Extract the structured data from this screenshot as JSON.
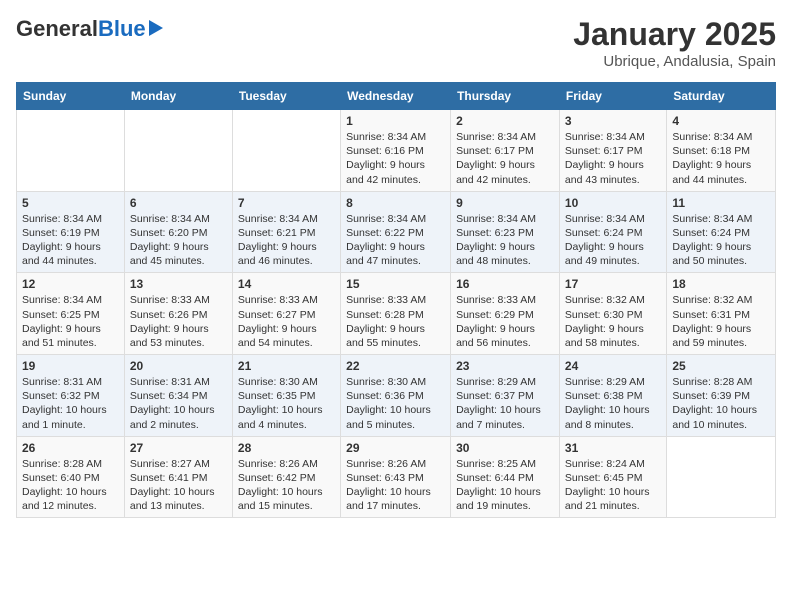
{
  "header": {
    "logo_general": "General",
    "logo_blue": "Blue",
    "month": "January 2025",
    "location": "Ubrique, Andalusia, Spain"
  },
  "days_of_week": [
    "Sunday",
    "Monday",
    "Tuesday",
    "Wednesday",
    "Thursday",
    "Friday",
    "Saturday"
  ],
  "weeks": [
    [
      {
        "day": "",
        "info": ""
      },
      {
        "day": "",
        "info": ""
      },
      {
        "day": "",
        "info": ""
      },
      {
        "day": "1",
        "info": "Sunrise: 8:34 AM\nSunset: 6:16 PM\nDaylight: 9 hours and 42 minutes."
      },
      {
        "day": "2",
        "info": "Sunrise: 8:34 AM\nSunset: 6:17 PM\nDaylight: 9 hours and 42 minutes."
      },
      {
        "day": "3",
        "info": "Sunrise: 8:34 AM\nSunset: 6:17 PM\nDaylight: 9 hours and 43 minutes."
      },
      {
        "day": "4",
        "info": "Sunrise: 8:34 AM\nSunset: 6:18 PM\nDaylight: 9 hours and 44 minutes."
      }
    ],
    [
      {
        "day": "5",
        "info": "Sunrise: 8:34 AM\nSunset: 6:19 PM\nDaylight: 9 hours and 44 minutes."
      },
      {
        "day": "6",
        "info": "Sunrise: 8:34 AM\nSunset: 6:20 PM\nDaylight: 9 hours and 45 minutes."
      },
      {
        "day": "7",
        "info": "Sunrise: 8:34 AM\nSunset: 6:21 PM\nDaylight: 9 hours and 46 minutes."
      },
      {
        "day": "8",
        "info": "Sunrise: 8:34 AM\nSunset: 6:22 PM\nDaylight: 9 hours and 47 minutes."
      },
      {
        "day": "9",
        "info": "Sunrise: 8:34 AM\nSunset: 6:23 PM\nDaylight: 9 hours and 48 minutes."
      },
      {
        "day": "10",
        "info": "Sunrise: 8:34 AM\nSunset: 6:24 PM\nDaylight: 9 hours and 49 minutes."
      },
      {
        "day": "11",
        "info": "Sunrise: 8:34 AM\nSunset: 6:24 PM\nDaylight: 9 hours and 50 minutes."
      }
    ],
    [
      {
        "day": "12",
        "info": "Sunrise: 8:34 AM\nSunset: 6:25 PM\nDaylight: 9 hours and 51 minutes."
      },
      {
        "day": "13",
        "info": "Sunrise: 8:33 AM\nSunset: 6:26 PM\nDaylight: 9 hours and 53 minutes."
      },
      {
        "day": "14",
        "info": "Sunrise: 8:33 AM\nSunset: 6:27 PM\nDaylight: 9 hours and 54 minutes."
      },
      {
        "day": "15",
        "info": "Sunrise: 8:33 AM\nSunset: 6:28 PM\nDaylight: 9 hours and 55 minutes."
      },
      {
        "day": "16",
        "info": "Sunrise: 8:33 AM\nSunset: 6:29 PM\nDaylight: 9 hours and 56 minutes."
      },
      {
        "day": "17",
        "info": "Sunrise: 8:32 AM\nSunset: 6:30 PM\nDaylight: 9 hours and 58 minutes."
      },
      {
        "day": "18",
        "info": "Sunrise: 8:32 AM\nSunset: 6:31 PM\nDaylight: 9 hours and 59 minutes."
      }
    ],
    [
      {
        "day": "19",
        "info": "Sunrise: 8:31 AM\nSunset: 6:32 PM\nDaylight: 10 hours and 1 minute."
      },
      {
        "day": "20",
        "info": "Sunrise: 8:31 AM\nSunset: 6:34 PM\nDaylight: 10 hours and 2 minutes."
      },
      {
        "day": "21",
        "info": "Sunrise: 8:30 AM\nSunset: 6:35 PM\nDaylight: 10 hours and 4 minutes."
      },
      {
        "day": "22",
        "info": "Sunrise: 8:30 AM\nSunset: 6:36 PM\nDaylight: 10 hours and 5 minutes."
      },
      {
        "day": "23",
        "info": "Sunrise: 8:29 AM\nSunset: 6:37 PM\nDaylight: 10 hours and 7 minutes."
      },
      {
        "day": "24",
        "info": "Sunrise: 8:29 AM\nSunset: 6:38 PM\nDaylight: 10 hours and 8 minutes."
      },
      {
        "day": "25",
        "info": "Sunrise: 8:28 AM\nSunset: 6:39 PM\nDaylight: 10 hours and 10 minutes."
      }
    ],
    [
      {
        "day": "26",
        "info": "Sunrise: 8:28 AM\nSunset: 6:40 PM\nDaylight: 10 hours and 12 minutes."
      },
      {
        "day": "27",
        "info": "Sunrise: 8:27 AM\nSunset: 6:41 PM\nDaylight: 10 hours and 13 minutes."
      },
      {
        "day": "28",
        "info": "Sunrise: 8:26 AM\nSunset: 6:42 PM\nDaylight: 10 hours and 15 minutes."
      },
      {
        "day": "29",
        "info": "Sunrise: 8:26 AM\nSunset: 6:43 PM\nDaylight: 10 hours and 17 minutes."
      },
      {
        "day": "30",
        "info": "Sunrise: 8:25 AM\nSunset: 6:44 PM\nDaylight: 10 hours and 19 minutes."
      },
      {
        "day": "31",
        "info": "Sunrise: 8:24 AM\nSunset: 6:45 PM\nDaylight: 10 hours and 21 minutes."
      },
      {
        "day": "",
        "info": ""
      }
    ]
  ]
}
